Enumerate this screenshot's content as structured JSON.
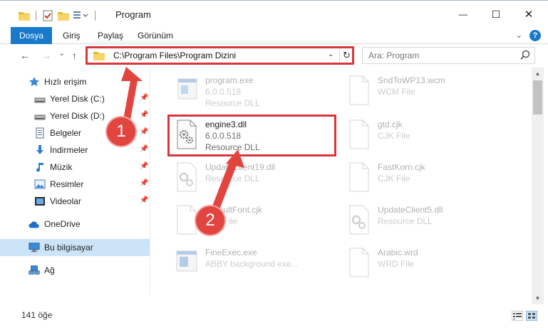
{
  "window": {
    "title": "Program",
    "minimize_glyph": "—",
    "maximize_glyph": "☐",
    "close_glyph": "✕"
  },
  "ribbon": {
    "tabs": [
      {
        "label": "Dosya",
        "active": true
      },
      {
        "label": "Giriş",
        "active": false
      },
      {
        "label": "Paylaş",
        "active": false
      },
      {
        "label": "Görünüm",
        "active": false
      }
    ],
    "help_glyph": "?"
  },
  "navigation": {
    "back_glyph": "←",
    "forward_glyph": "→",
    "recent_glyph": "⌄",
    "up_glyph": "↑",
    "address": "C:\\Program Files\\Program Dizini",
    "search_placeholder": "Ara: Program"
  },
  "sidebar": {
    "items": [
      {
        "label": "Hızlı erişim",
        "icon": "star-icon",
        "pinned": false
      },
      {
        "label": "Yerel Disk (C:)",
        "icon": "drive-icon",
        "pinned": true
      },
      {
        "label": "Yerel Disk (D:)",
        "icon": "drive-icon",
        "pinned": true
      },
      {
        "label": "Belgeler",
        "icon": "documents-icon",
        "pinned": true
      },
      {
        "label": "İndirmeler",
        "icon": "download-icon",
        "pinned": true
      },
      {
        "label": "Müzik",
        "icon": "music-icon",
        "pinned": true
      },
      {
        "label": "Resimler",
        "icon": "pictures-icon",
        "pinned": true
      },
      {
        "label": "Videolar",
        "icon": "videos-icon",
        "pinned": true
      },
      {
        "label": "OneDrive",
        "icon": "cloud-icon",
        "pinned": false
      },
      {
        "label": "Bu bilgisayar",
        "icon": "computer-icon",
        "pinned": false,
        "selected": true
      },
      {
        "label": "Ağ",
        "icon": "network-icon",
        "pinned": false
      }
    ]
  },
  "files": [
    {
      "name": "program.exe",
      "version": "6.0.0.518",
      "type": "Resource DLL",
      "faded": true
    },
    {
      "name": "SndToWP13.wcm",
      "version": "",
      "type": "WCM File",
      "faded": true
    },
    {
      "name": "engine3.dll",
      "version": "6.0.0.518",
      "type": "Resource DLL",
      "faded": false
    },
    {
      "name": "gtd.cjk",
      "version": "",
      "type": "CJK File",
      "faded": true
    },
    {
      "name": "UpdateClient19.dll",
      "version": "",
      "type": "Resource DLL",
      "faded": true
    },
    {
      "name": "FastKorn.cjk",
      "version": "",
      "type": "CJK File",
      "faded": true
    },
    {
      "name": "DefaultFont.cjk",
      "version": "",
      "type": "CJK File",
      "faded": true
    },
    {
      "name": "UpdateClient5.dll",
      "version": "",
      "type": "Resource DLL",
      "faded": true
    },
    {
      "name": "FineExec.exe",
      "version": "",
      "type": "ABBY background exe...",
      "faded": true
    },
    {
      "name": "Arabic.wrd",
      "version": "",
      "type": "WRD File",
      "faded": true
    }
  ],
  "status": {
    "item_count": "141 öğe"
  },
  "annotations": {
    "step1": "1",
    "step2": "2"
  }
}
